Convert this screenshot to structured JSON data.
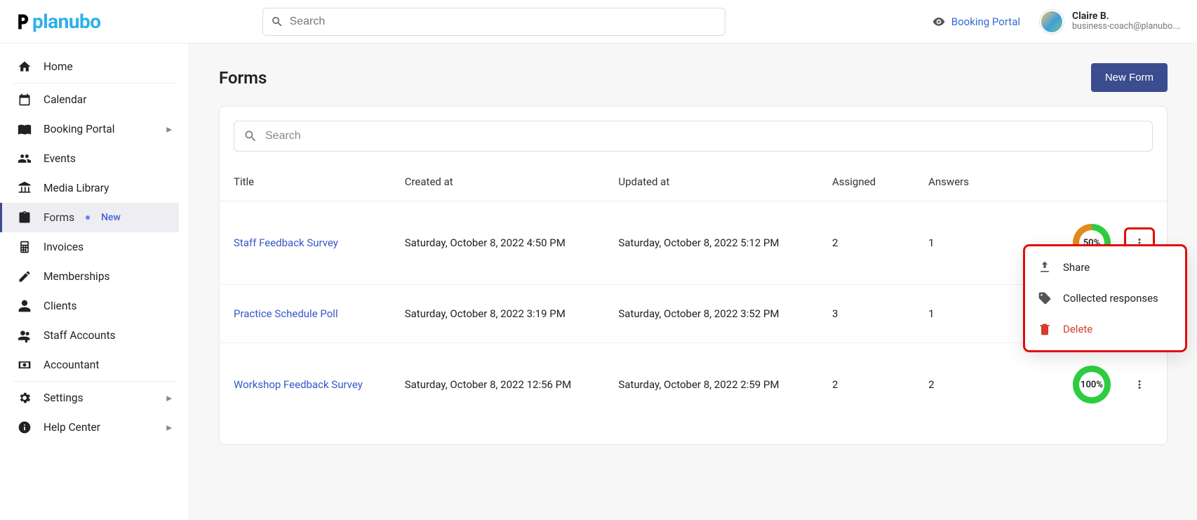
{
  "header": {
    "logo_text": "planubo",
    "search_placeholder": "Search",
    "portal_label": "Booking Portal",
    "user_name": "Claire B.",
    "user_email": "business-coach@planubo.c..."
  },
  "sidebar": {
    "items": [
      {
        "key": "home",
        "label": "Home"
      },
      {
        "key": "calendar",
        "label": "Calendar"
      },
      {
        "key": "booking-portal",
        "label": "Booking Portal",
        "expand": true
      },
      {
        "key": "events",
        "label": "Events"
      },
      {
        "key": "media-library",
        "label": "Media Library"
      },
      {
        "key": "forms",
        "label": "Forms",
        "active": true,
        "new": true,
        "new_label": "New"
      },
      {
        "key": "invoices",
        "label": "Invoices"
      },
      {
        "key": "memberships",
        "label": "Memberships"
      },
      {
        "key": "clients",
        "label": "Clients"
      },
      {
        "key": "staff-accounts",
        "label": "Staff Accounts"
      },
      {
        "key": "accountant",
        "label": "Accountant"
      },
      {
        "key": "settings",
        "label": "Settings",
        "expand": true
      },
      {
        "key": "help-center",
        "label": "Help Center",
        "expand": true
      }
    ]
  },
  "page": {
    "title": "Forms",
    "new_button": "New Form",
    "list_search_placeholder": "Search"
  },
  "columns": {
    "title": "Title",
    "created": "Created at",
    "updated": "Updated at",
    "assigned": "Assigned",
    "answers": "Answers"
  },
  "rows": [
    {
      "title": "Staff Feedback Survey",
      "created": "Saturday, October 8, 2022 4:50 PM",
      "updated": "Saturday, October 8, 2022 5:12 PM",
      "assigned": "2",
      "answers": "1",
      "pct": "50%",
      "ring": "ring50",
      "menu_open": true,
      "highlight_kebab": true
    },
    {
      "title": "Practice Schedule Poll",
      "created": "Saturday, October 8, 2022 3:19 PM",
      "updated": "Saturday, October 8, 2022 3:52 PM",
      "assigned": "3",
      "answers": "1",
      "pct": "",
      "ring": "",
      "menu_open": false,
      "highlight_kebab": false
    },
    {
      "title": "Workshop Feedback Survey",
      "created": "Saturday, October 8, 2022 12:56 PM",
      "updated": "Saturday, October 8, 2022 2:59 PM",
      "assigned": "2",
      "answers": "2",
      "pct": "100%",
      "ring": "ring100",
      "menu_open": false,
      "highlight_kebab": false
    }
  ],
  "menu": {
    "share": "Share",
    "collected": "Collected responses",
    "delete": "Delete"
  }
}
